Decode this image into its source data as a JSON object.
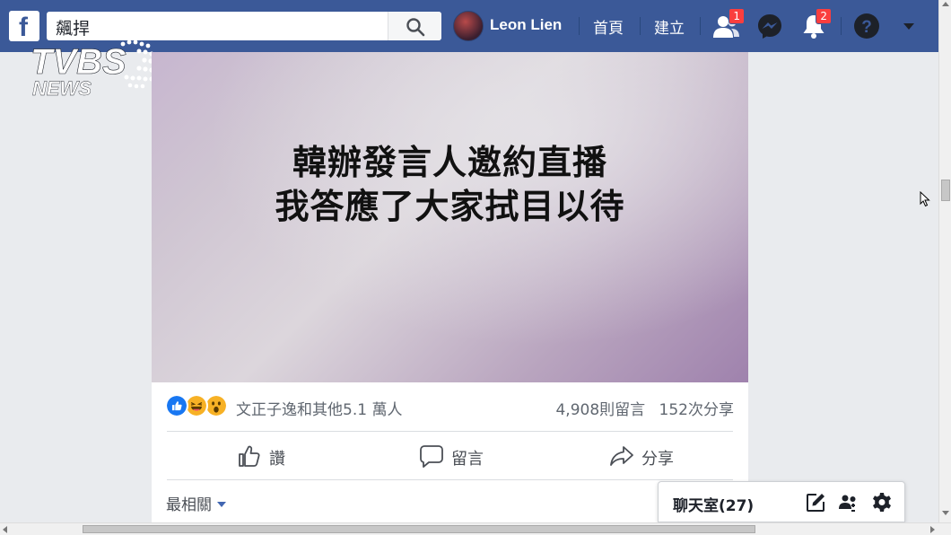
{
  "topbar": {
    "search_value": "飆捍",
    "user_name": "Leon Lien",
    "nav_home": "首頁",
    "nav_create": "建立",
    "friend_requests_count": "1",
    "notifications_count": "2"
  },
  "watermark": {
    "brand": "TVBS",
    "sub": "NEWS"
  },
  "post": {
    "image_text_line1": "韓辦發言人邀約直播",
    "image_text_line2": "我答應了大家拭目以待",
    "reactions_summary": "文正子逸和其他5.1 萬人",
    "comments_count": "4,908則留言",
    "shares_count": "152次分享",
    "like_label": "讚",
    "comment_label": "留言",
    "share_label": "分享",
    "sort_label": "最相關"
  },
  "chat": {
    "title": "聊天室(27)"
  },
  "colors": {
    "facebook_blue": "#3b5998",
    "badge_red": "#fa3e3e",
    "link_blue": "#4267b2"
  }
}
